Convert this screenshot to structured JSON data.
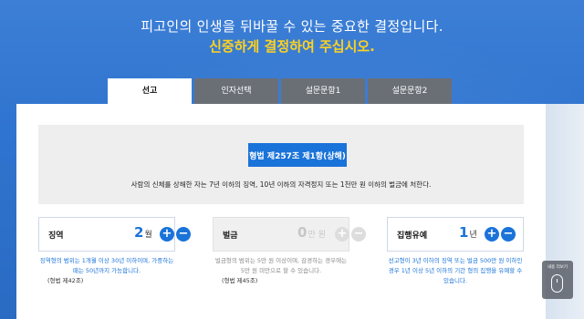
{
  "headline": "피고인의 인생을 뒤바꿀 수 있는 중요한 결정입니다.",
  "subline": "신중하게 결정하여 주십시오.",
  "tabs": [
    {
      "label": "선고",
      "active": true
    },
    {
      "label": "인자선택",
      "active": false
    },
    {
      "label": "설문문항1",
      "active": false
    },
    {
      "label": "설문문항2",
      "active": false
    }
  ],
  "law": {
    "button_label": "형법 제257조 제1항(상해)",
    "text": "사람의 신체를 상해한 자는 7년 이하의 징역, 10년 이하의 자격정지 또는 1천만 원 이하의 벌금에 처한다."
  },
  "cards": [
    {
      "label": "징역",
      "value": "2",
      "unit": "월",
      "enabled": true,
      "desc": "징역형의 범위는 1개월 이상 30년 이하이며, 가중하는 때는 50년까지 가능합니다.",
      "ref": "(형법 제42조)"
    },
    {
      "label": "벌금",
      "value": "0",
      "unit": "만 원",
      "enabled": false,
      "desc": "벌금형의 범위는 5만 원 이상이며, 감경하는 경우에는 5만 원 미만으로 할 수 있습니다.",
      "ref": "(형법 제45조)"
    },
    {
      "label": "집행유예",
      "value": "1",
      "unit": "년",
      "enabled": true,
      "desc": "선고형이 3년 이하의 징역 또는 벌금 500만 원 이하인 경우 1년 이상 5년 이하의 기간 형의 집행을 유예할 수 있습니다.",
      "ref": ""
    }
  ],
  "plus_symbol": "+",
  "minus_symbol": "−",
  "side_widget": {
    "label": "내용 더보기",
    "icon": "mouse-icon"
  },
  "colors": {
    "accent": "#1a73d9",
    "highlight": "#ffd21f",
    "tab_inactive": "#6a6f76"
  }
}
